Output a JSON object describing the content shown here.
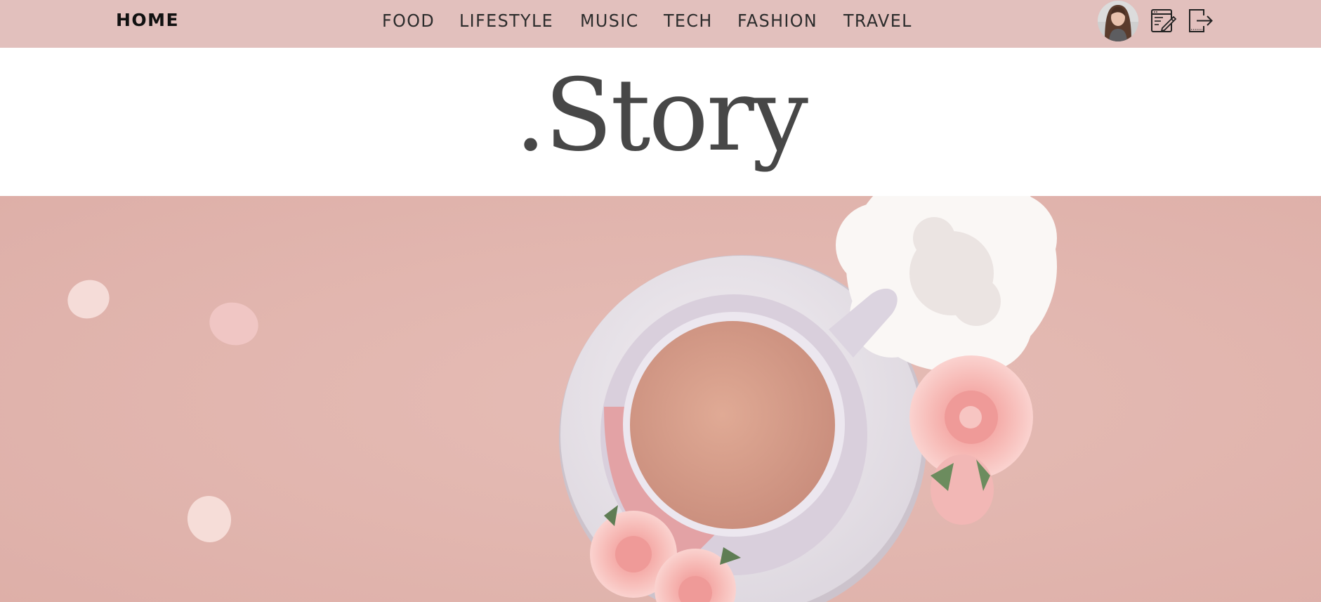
{
  "navbar": {
    "home_label": "HOME",
    "links": [
      {
        "label": "FOOD"
      },
      {
        "label": "LIFESTYLE"
      },
      {
        "label": "MUSIC"
      },
      {
        "label": "TECH"
      },
      {
        "label": "FASHION"
      },
      {
        "label": "TRAVEL"
      }
    ],
    "avatar_icon": "user-avatar",
    "write_icon": "edit-note-icon",
    "logout_icon": "logout-icon"
  },
  "header": {
    "site_title": ".Story"
  },
  "hero": {
    "image_subject": "coffee-cup-with-flowers"
  },
  "colors": {
    "navbar_bg": "#e2c0bd",
    "title_text": "#474747",
    "hero_bg": "#e4b8b2"
  }
}
